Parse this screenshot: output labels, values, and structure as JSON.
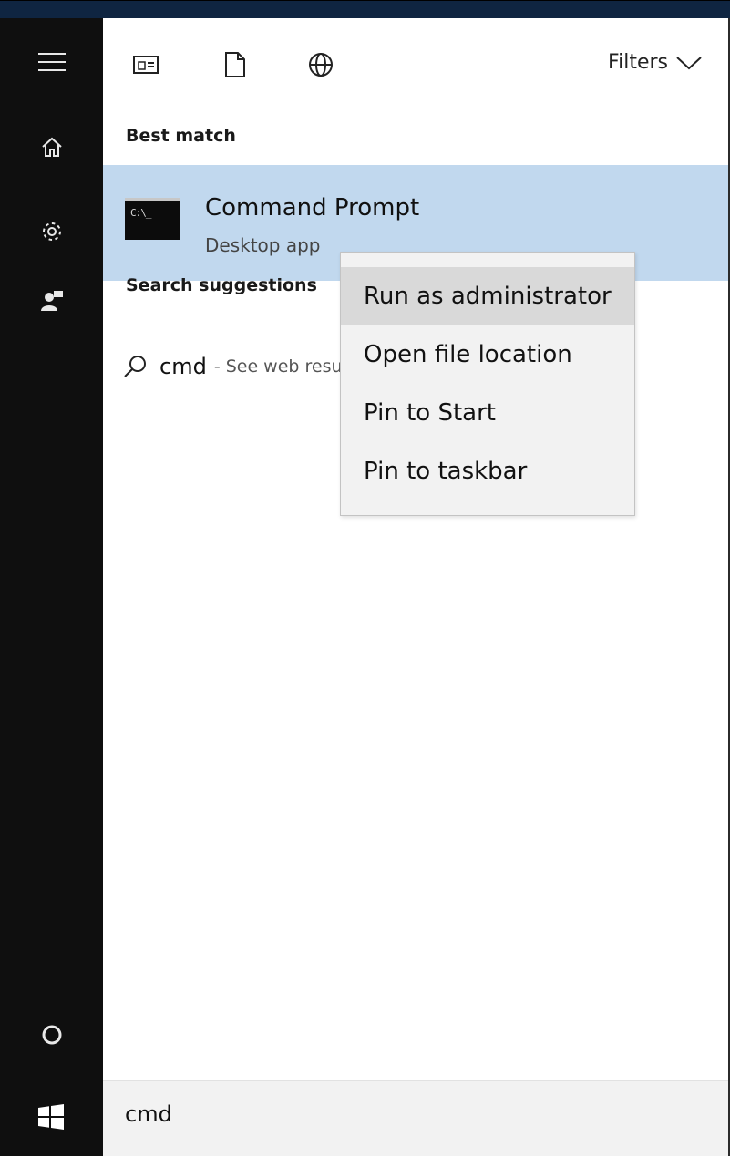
{
  "rail": {
    "icons": [
      "hamburger-icon",
      "home-icon",
      "gear-icon",
      "user-feedback-icon",
      "cortana-circle-icon",
      "windows-logo-icon"
    ]
  },
  "scope_bar": {
    "icons": [
      "apps-scope-icon",
      "documents-scope-icon",
      "web-scope-icon"
    ],
    "filters_label": "Filters"
  },
  "best_match": {
    "section_label": "Best match",
    "app_name": "Command Prompt",
    "app_type": "Desktop app",
    "icon_text": "C:\\_"
  },
  "suggestions": {
    "section_label": "Search suggestions",
    "items": [
      {
        "query": "cmd",
        "hint": "- See web results"
      }
    ]
  },
  "context_menu": {
    "items": [
      {
        "label": "Run as administrator",
        "hovered": true
      },
      {
        "label": "Open file location",
        "hovered": false
      },
      {
        "label": "Pin to Start",
        "hovered": false
      },
      {
        "label": "Pin to taskbar",
        "hovered": false
      }
    ]
  },
  "search": {
    "value": "cmd"
  },
  "colors": {
    "rail_bg": "#0f0f0f",
    "highlight": "#c1d8ee",
    "menu_bg": "#f2f2f2",
    "menu_hover": "#d9d9d9"
  }
}
